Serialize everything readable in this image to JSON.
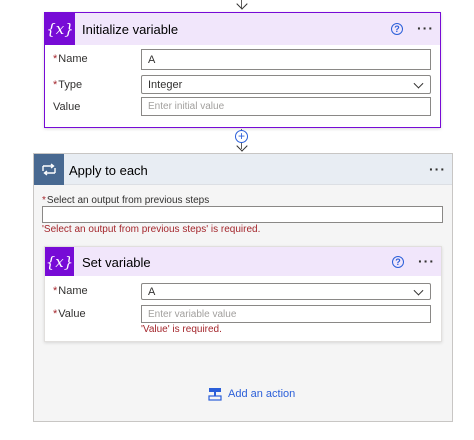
{
  "init_variable": {
    "icon": "variable-icon",
    "icon_glyph": "{x}",
    "title": "Initialize variable",
    "help_glyph": "?",
    "more_glyph": "···",
    "name_label": "Name",
    "name_value": "A",
    "type_label": "Type",
    "type_value": "Integer",
    "value_label": "Value",
    "value_placeholder": "Enter initial value"
  },
  "connector": {
    "plus_glyph": "+"
  },
  "apply_to_each": {
    "icon": "loop-icon",
    "title": "Apply to each",
    "more_glyph": "···",
    "select_label": "Select an output from previous steps",
    "select_value": "",
    "select_error": "'Select an output from previous steps' is required."
  },
  "set_variable": {
    "icon": "variable-icon",
    "icon_glyph": "{x}",
    "title": "Set variable",
    "help_glyph": "?",
    "more_glyph": "···",
    "name_label": "Name",
    "name_value": "A",
    "value_label": "Value",
    "value_placeholder": "Enter variable value",
    "value_error": "'Value' is required."
  },
  "add_action": {
    "icon": "add-action-icon",
    "label": "Add an action"
  },
  "colors": {
    "variable_accent": "#770bd6",
    "variable_header_bg": "#f1e6fb",
    "loop_accent": "#486991",
    "loop_header_bg": "#e8edf3",
    "error": "#a4262c",
    "link": "#2b5fd9"
  }
}
